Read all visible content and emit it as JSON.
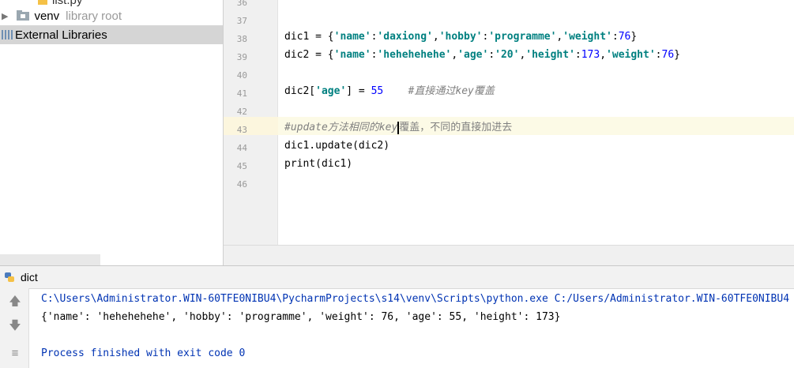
{
  "project": {
    "partial_file": "list.py",
    "venv_label": "venv",
    "venv_sub": "library root",
    "ext_libs_label": "External Libraries"
  },
  "editor": {
    "line_numbers": [
      "36",
      "37",
      "38",
      "39",
      "40",
      "41",
      "42",
      "43",
      "44",
      "45",
      "46"
    ],
    "lines": {
      "l38": {
        "pre": "dic1 = {",
        "s1": "'name'",
        "c1": ":",
        "s2": "'daxiong'",
        "c2": ",",
        "s3": "'hobby'",
        "c3": ":",
        "s4": "'programme'",
        "c4": ",",
        "s5": "'weight'",
        "c5": ":",
        "n1": "76",
        "end": "}"
      },
      "l39": {
        "pre": "dic2 = {",
        "s1": "'name'",
        "c1": ":",
        "s2": "'hehehehehe'",
        "c2": ",",
        "s3": "'age'",
        "c3": ":",
        "s4": "'20'",
        "c4": ",",
        "s5": "'height'",
        "c5": ":",
        "n1": "173",
        "c6": ",",
        "s6": "'weight'",
        "c7": ":",
        "n2": "76",
        "end": "}"
      },
      "l41": {
        "pre": "dic2[",
        "s1": "'age'",
        "mid": "] = ",
        "n1": "55",
        "cmt": "    #直接通过key覆盖"
      },
      "l43": {
        "cmt_a": "#update方法相同的key",
        "cmt_b": "覆盖，不同的直接加进去"
      },
      "l44": "dic1.update(dic2)",
      "l45": "print(dic1)"
    }
  },
  "run": {
    "tab_label": "dict",
    "cmd": "C:\\Users\\Administrator.WIN-60TFE0NIBU4\\PycharmProjects\\s14\\venv\\Scripts\\python.exe C:/Users/Administrator.WIN-60TFE0NIBU4",
    "output": "{'name': 'hehehehehe', 'hobby': 'programme', 'weight': 76, 'age': 55, 'height': 173}",
    "exit": "Process finished with exit code 0"
  },
  "colors": {
    "string": "#008080",
    "number": "#0000ff",
    "comment": "#808080",
    "console_blue": "#0033b3"
  },
  "icons": [
    "folder-icon",
    "python-file-icon",
    "library-icon",
    "python-icon",
    "rerun-up-icon",
    "down-icon",
    "soft-wrap-icon",
    "chevron-right-icon"
  ]
}
